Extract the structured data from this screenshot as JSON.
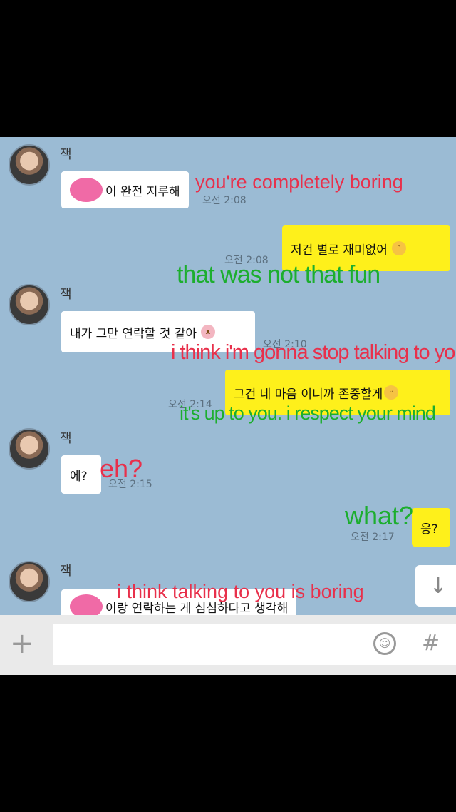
{
  "colors": {
    "chat_bg": "#9bbbd4",
    "incoming_bubble": "#ffffff",
    "outgoing_bubble": "#fef01b",
    "annotation_red": "#e8304b",
    "annotation_green": "#1cae2e"
  },
  "messages": [
    {
      "sender": "잭",
      "text": "이 완전 지루해",
      "time": "오전 2:08",
      "annotation": "you're completely boring"
    },
    {
      "text": "저건 별로 재미없어",
      "time": "오전 2:08",
      "emoji": "sweat-smile-emoji",
      "annotation": "that was not that fun"
    },
    {
      "sender": "잭",
      "text": "내가 그만 연락할 것 같아",
      "time": "오전 2:10",
      "emoji": "pig-face-emoji",
      "annotation": "i think i'm gonna stop talking to you"
    },
    {
      "text": "그건 네 마음 이니까 존중할게",
      "time": "오전 2:14",
      "emoji": "sad-face-emoji",
      "annotation": "it's up to you. i respect your mind"
    },
    {
      "sender": "잭",
      "text": "에?",
      "time": "오전 2:15",
      "annotation": "eh?"
    },
    {
      "text": "응?",
      "time": "오전 2:17",
      "annotation": "what?"
    },
    {
      "sender": "잭",
      "text": "이랑 연락하는 게 심심하다고 생각해",
      "annotation": "i think talking to you is boring"
    }
  ],
  "scroll_button": {
    "icon": "down-arrow-icon",
    "glyph": "↓"
  },
  "input_bar": {
    "plus_glyph": "+",
    "emoji_glyph": "☺",
    "hash_glyph": "#",
    "placeholder": ""
  }
}
